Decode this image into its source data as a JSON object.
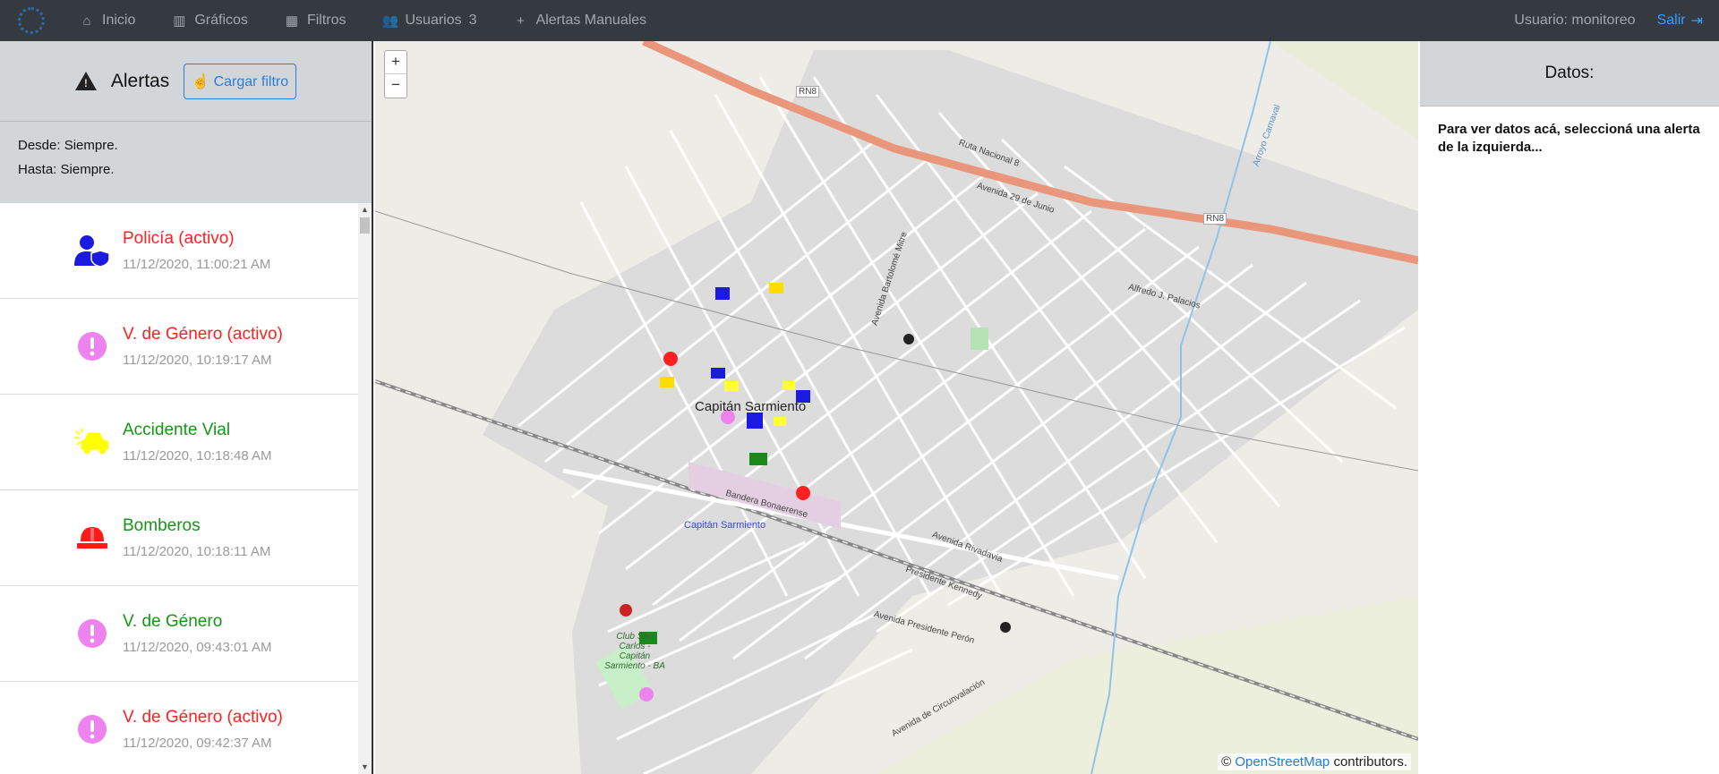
{
  "nav": {
    "items": [
      {
        "label": "Inicio",
        "icon": "home-icon"
      },
      {
        "label": "Gráficos",
        "icon": "bar-chart-icon"
      },
      {
        "label": "Filtros",
        "icon": "map-icon"
      },
      {
        "label": "Usuarios",
        "icon": "users-icon",
        "badge": "3"
      },
      {
        "label": "Alertas Manuales",
        "icon": "plus-icon"
      }
    ],
    "user_label": "Usuario: monitoreo",
    "logout_label": "Salir"
  },
  "left_panel": {
    "title": "Alertas",
    "load_filter_label": "Cargar filtro",
    "desde": "Desde: Siempre.",
    "hasta": "Hasta: Siempre."
  },
  "alerts": [
    {
      "name": "Policía (activo)",
      "time": "11/12/2020, 11:00:21 AM",
      "color": "red",
      "icon": "police-icon"
    },
    {
      "name": "V. de Género (activo)",
      "time": "11/12/2020, 10:19:17 AM",
      "color": "red",
      "icon": "exclamation-circle-icon"
    },
    {
      "name": "Accidente Vial",
      "time": "11/12/2020, 10:18:48 AM",
      "color": "green",
      "icon": "car-crash-icon"
    },
    {
      "name": "Bomberos",
      "time": "11/12/2020, 10:18:11 AM",
      "color": "green",
      "icon": "firefighter-helmet-icon"
    },
    {
      "name": "V. de Género",
      "time": "11/12/2020, 09:43:01 AM",
      "color": "green",
      "icon": "exclamation-circle-icon"
    },
    {
      "name": "V. de Género (activo)",
      "time": "11/12/2020, 09:42:37 AM",
      "color": "red",
      "icon": "exclamation-circle-icon"
    }
  ],
  "map": {
    "zoom_in": "+",
    "zoom_out": "−",
    "city": "Capitán Sarmiento",
    "station": "Capitán Sarmiento",
    "attribution_prefix": "©",
    "attribution_link": "OpenStreetMap",
    "attribution_suffix": "contributors.",
    "streets": [
      "Ruta Nacional 8",
      "RN8",
      "Avenida 29 de Junio",
      "Alfredo J. Palacios",
      "Avenida Bartolomé Mitre",
      "Avenida Rivadavia",
      "Presidente Kennedy",
      "Avenida Presidente Perón",
      "Avenida de Circunvalación",
      "Bandera Bonaerense",
      "Club San Carlos - Capitán Sarmiento - BA",
      "Arroyo Carnaval"
    ]
  },
  "right_panel": {
    "title": "Datos:",
    "hint": "Para ver datos acá, seleccioná una alerta de la izquierda..."
  }
}
